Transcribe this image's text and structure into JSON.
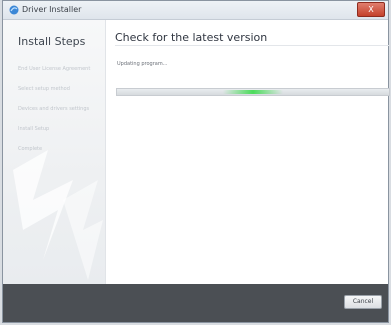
{
  "window": {
    "title": "Driver Installer",
    "close_label": "X"
  },
  "sidebar": {
    "title": "Install Steps",
    "steps": [
      "End User License Agreement",
      "Select setup method",
      "Devices and drivers settings",
      "Install Setup",
      "Complete"
    ]
  },
  "main": {
    "title": "Check for the latest version",
    "status": "Updating program...",
    "progress_percent": 50
  },
  "footer": {
    "cancel_label": "Cancel"
  }
}
